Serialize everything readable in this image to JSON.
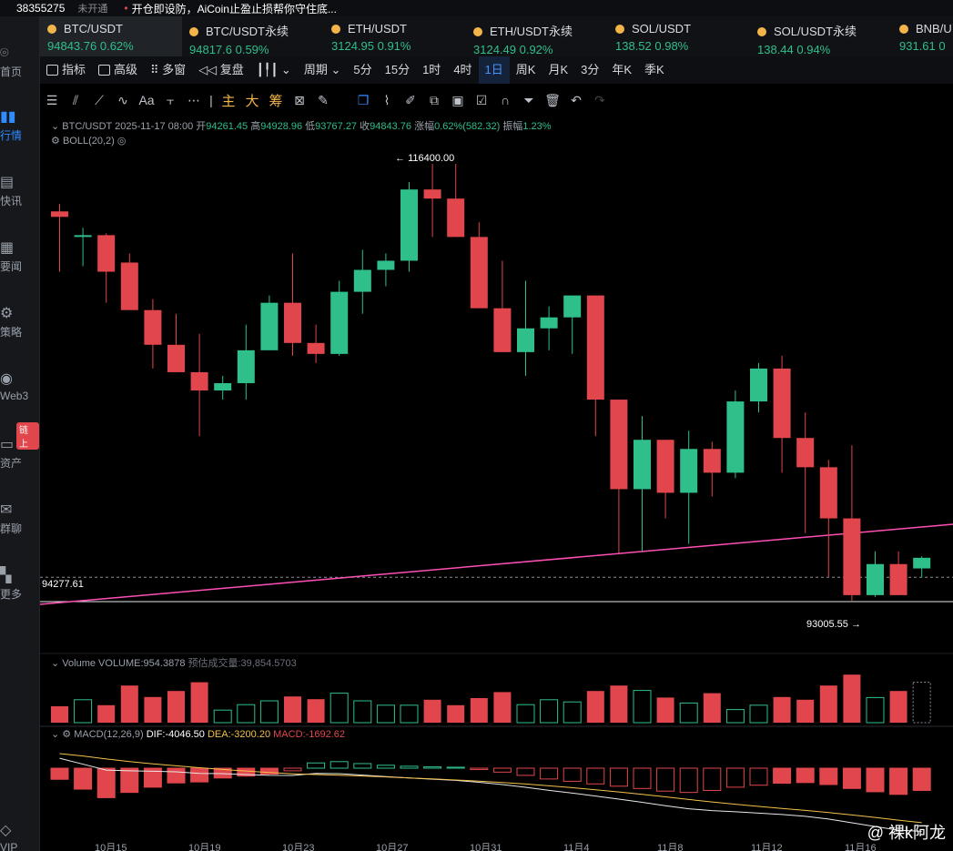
{
  "topbar": {
    "uid": "38355275",
    "badge": "未开通",
    "notice": "开仓即设防，AiCoin止盈止损帮你守住底..."
  },
  "sidebar": [
    {
      "icon": "home-icon",
      "label": "首页"
    },
    {
      "icon": "market-icon",
      "label": "行情"
    },
    {
      "icon": "flash-icon",
      "label": "快讯"
    },
    {
      "icon": "news-icon",
      "label": "要闻"
    },
    {
      "icon": "strategy-icon",
      "label": "策略"
    },
    {
      "icon": "web3-icon",
      "label": "Web3"
    },
    {
      "icon": "wallet-icon",
      "label": "资产"
    },
    {
      "icon": "chat-icon",
      "label": "群聊"
    },
    {
      "icon": "more-icon",
      "label": "更多"
    },
    {
      "icon": "vip-icon",
      "label": "VIP"
    }
  ],
  "sidebar_tag": "链上",
  "tickers": [
    {
      "name": "BTC/USDT",
      "price": "94843.76",
      "change": "0.62%"
    },
    {
      "name": "BTC/USDT永续",
      "price": "94817.6",
      "change": "0.59%"
    },
    {
      "name": "ETH/USDT",
      "price": "3124.95",
      "change": "0.91%"
    },
    {
      "name": "ETH/USDT永续",
      "price": "3124.49",
      "change": "0.92%"
    },
    {
      "name": "SOL/USDT",
      "price": "138.52",
      "change": "0.98%"
    },
    {
      "name": "SOL/USDT永续",
      "price": "138.44",
      "change": "0.94%"
    },
    {
      "name": "BNB/U",
      "price": "931.61",
      "change": "0"
    }
  ],
  "periodbar": {
    "indicator": "指标",
    "advanced": "高级",
    "multi": "多窗",
    "replay": "复盘",
    "period": "周期",
    "items": [
      "5分",
      "15分",
      "1时",
      "4时",
      "1日",
      "周K",
      "月K",
      "3分",
      "年K",
      "季K"
    ],
    "selected": "1日"
  },
  "drawbar": {
    "main": "主",
    "big": "大",
    "chip": "筹",
    "font": "Aa"
  },
  "chart": {
    "info": {
      "symbol": "BTC/USDT",
      "datetime": "2025-11-17 08:00",
      "open_label": "开",
      "open": "94261.45",
      "high_label": "高",
      "high": "94928.96",
      "low_label": "低",
      "low": "93767.27",
      "close_label": "收",
      "close": "94843.76",
      "chg_label": "涨幅",
      "chg": "0.62%(582.32)",
      "amp_label": "振幅",
      "amp": "1.23%"
    },
    "boll": "BOLL(20,2)",
    "high_mark": "116400.00",
    "low_mark": "93005.55",
    "level": "94277.61",
    "volume": {
      "label": "Volume",
      "value": "VOLUME:954.3878",
      "est": "预估成交量:39,854.5703"
    },
    "macd": {
      "label": "MACD(12,26,9)",
      "dif": "DIF:-4046.50",
      "dea": "DEA:-3200.20",
      "macd": "MACD:-1692.62"
    },
    "xlabels": [
      "10月15",
      "10月19",
      "10月23",
      "10月27",
      "10月31",
      "11月4",
      "11月8",
      "11月12",
      "11月16"
    ]
  },
  "watermark": "@ 裸k阿龙",
  "colors": {
    "up": "#2fbf8a",
    "down": "#e0464b",
    "accent": "#2f8cff",
    "trendline": "#ff4fb5"
  },
  "chart_data": {
    "type": "candlestick",
    "ohlc": [
      [
        113800,
        114200,
        110500,
        113500
      ],
      [
        112500,
        112900,
        110800,
        112500
      ],
      [
        112500,
        112600,
        108800,
        110500
      ],
      [
        111000,
        111500,
        108500,
        108400
      ],
      [
        108400,
        109000,
        105200,
        106500
      ],
      [
        106500,
        108200,
        105200,
        105000
      ],
      [
        105000,
        107100,
        101500,
        104000
      ],
      [
        104000,
        104800,
        103500,
        104400
      ],
      [
        104400,
        107600,
        103500,
        106200
      ],
      [
        106200,
        109200,
        106200,
        108800
      ],
      [
        108800,
        111500,
        105900,
        106600
      ],
      [
        106600,
        107600,
        105500,
        106000
      ],
      [
        106000,
        110000,
        105900,
        109400
      ],
      [
        109400,
        111700,
        108200,
        110600
      ],
      [
        110600,
        111500,
        109700,
        111100
      ],
      [
        111100,
        115400,
        110500,
        115000
      ],
      [
        115000,
        116400,
        112400,
        114500
      ],
      [
        114500,
        116400,
        113000,
        112400
      ],
      [
        112400,
        113200,
        108900,
        108500
      ],
      [
        108500,
        111100,
        107500,
        106100
      ],
      [
        106100,
        110000,
        104800,
        107400
      ],
      [
        107400,
        108600,
        106200,
        108000
      ],
      [
        108000,
        109100,
        106000,
        109200
      ],
      [
        109200,
        109200,
        101500,
        103500
      ],
      [
        103500,
        102500,
        95100,
        98600
      ],
      [
        98600,
        102600,
        95200,
        101300
      ],
      [
        101300,
        101300,
        97000,
        98400
      ],
      [
        98400,
        101800,
        95600,
        100800
      ],
      [
        100800,
        101200,
        98200,
        99500
      ],
      [
        99500,
        104000,
        99200,
        103400
      ],
      [
        103400,
        105500,
        102800,
        105200
      ],
      [
        105200,
        105900,
        99500,
        101400
      ],
      [
        101400,
        102800,
        96200,
        99800
      ],
      [
        99800,
        100200,
        93800,
        97000
      ],
      [
        97000,
        101000,
        92500,
        92800
      ],
      [
        92800,
        95200,
        92700,
        94500
      ],
      [
        94500,
        95200,
        93006,
        92800
      ],
      [
        94261,
        94929,
        93767,
        94844
      ]
    ],
    "volume": [
      0.3,
      0.42,
      0.32,
      0.68,
      0.47,
      0.58,
      0.74,
      0.23,
      0.33,
      0.4,
      0.48,
      0.43,
      0.54,
      0.4,
      0.32,
      0.32,
      0.42,
      0.32,
      0.45,
      0.56,
      0.33,
      0.42,
      0.38,
      0.58,
      0.68,
      0.59,
      0.46,
      0.36,
      0.54,
      0.24,
      0.32,
      0.47,
      0.42,
      0.68,
      0.88,
      0.46,
      0.58,
      0.74
    ],
    "macd_hist": [
      -0.34,
      -0.64,
      -0.9,
      -0.74,
      -0.58,
      -0.45,
      -0.42,
      -0.3,
      -0.24,
      -0.18,
      -0.08,
      0.16,
      0.2,
      0.14,
      0.09,
      0.06,
      0.04,
      0.03,
      -0.04,
      -0.12,
      -0.22,
      -0.33,
      -0.4,
      -0.48,
      -0.55,
      -0.62,
      -0.7,
      -0.74,
      -0.68,
      -0.58,
      -0.52,
      -0.46,
      -0.44,
      -0.5,
      -0.62,
      -0.72,
      -0.8,
      -0.68
    ]
  }
}
